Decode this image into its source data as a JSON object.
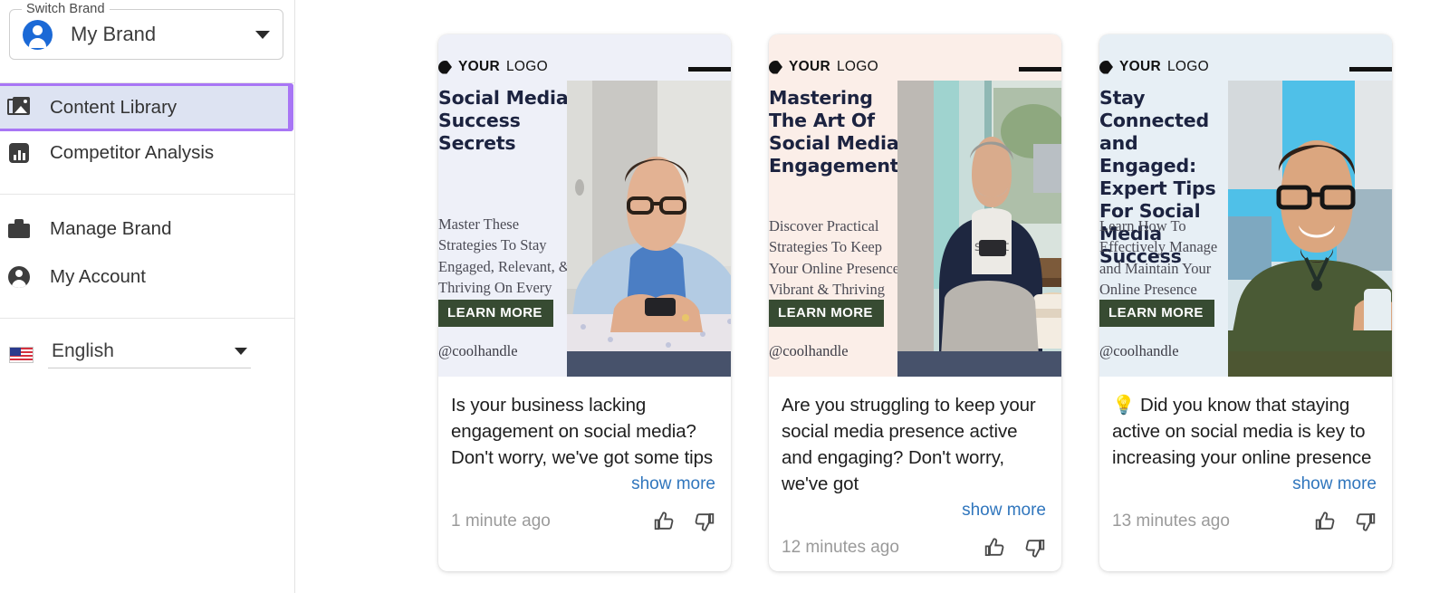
{
  "sidebar": {
    "brand_select": {
      "legend": "Switch Brand",
      "value": "My Brand",
      "avatar_icon": "account-circle-icon",
      "caret_icon": "chevron-down-icon"
    },
    "nav_primary": [
      {
        "label": "Content Library",
        "icon": "photo-library-icon",
        "selected": true
      },
      {
        "label": "Competitor Analysis",
        "icon": "bar-chart-icon",
        "selected": false
      }
    ],
    "nav_secondary": [
      {
        "label": "Manage Brand",
        "icon": "briefcase-icon",
        "selected": false
      },
      {
        "label": "My Account",
        "icon": "account-circle-icon",
        "selected": false
      }
    ],
    "language": {
      "value": "English",
      "flag_icon": "us-flag-icon",
      "caret_icon": "chevron-down-icon"
    },
    "selected_accent": "#a876f5",
    "selected_fill": "#dde3f2"
  },
  "content_library": {
    "cards": [
      {
        "preview": {
          "bg": "#eef0f8",
          "logo_bold": "YOUR",
          "logo_light": "LOGO",
          "headline": "Social Media Success Secrets",
          "subtext": "Master These Strategies To Stay Engaged, Relevant, & Thriving On Every Platform",
          "cta": "LEARN MORE",
          "handle": "@coolhandle",
          "bottom_bar": "#47526b",
          "photo_desc": "man in light blue shirt with glasses using a phone at a table"
        },
        "caption": "Is your business lacking engagement on social media? Don't worry, we've got some tips",
        "show_more": "show more",
        "timestamp": "1 minute ago",
        "thumb_up_icon": "thumb-up-icon",
        "thumb_down_icon": "thumb-down-icon"
      },
      {
        "preview": {
          "bg": "#fbeee8",
          "logo_bold": "YOUR",
          "logo_light": "LOGO",
          "headline": "Mastering The Art Of Social Media Engagement",
          "subtext": "Discover Practical Strategies To Keep Your Online Presence Vibrant & Thriving",
          "cta": "LEARN MORE",
          "handle": "@coolhandle",
          "bottom_bar": "#47526b",
          "photo_desc": "man in navy hoodie at a cafe counter looking at his phone"
        },
        "caption": "Are you struggling to keep your social media presence active and engaging? Don't worry, we've got",
        "show_more": "show more",
        "timestamp": "12 minutes ago",
        "thumb_up_icon": "thumb-up-icon",
        "thumb_down_icon": "thumb-down-icon"
      },
      {
        "preview": {
          "bg": "#e7eff5",
          "logo_bold": "YOUR",
          "logo_light": "LOGO",
          "headline": "Stay Connected and Engaged: Expert Tips For Social Media Success",
          "subtext": "Learn How To Effectively Manage and Maintain Your Online Presence",
          "cta": "LEARN MORE",
          "handle": "@coolhandle",
          "bottom_bar": "#4d5632",
          "photo_desc": "smiling bearded man with glasses in an olive shirt holding a phone"
        },
        "caption": "💡 Did you know that staying active on social media is key to increasing your online presence",
        "show_more": "show more",
        "timestamp": "13 minutes ago",
        "thumb_up_icon": "thumb-up-icon",
        "thumb_down_icon": "thumb-down-icon"
      }
    ]
  }
}
